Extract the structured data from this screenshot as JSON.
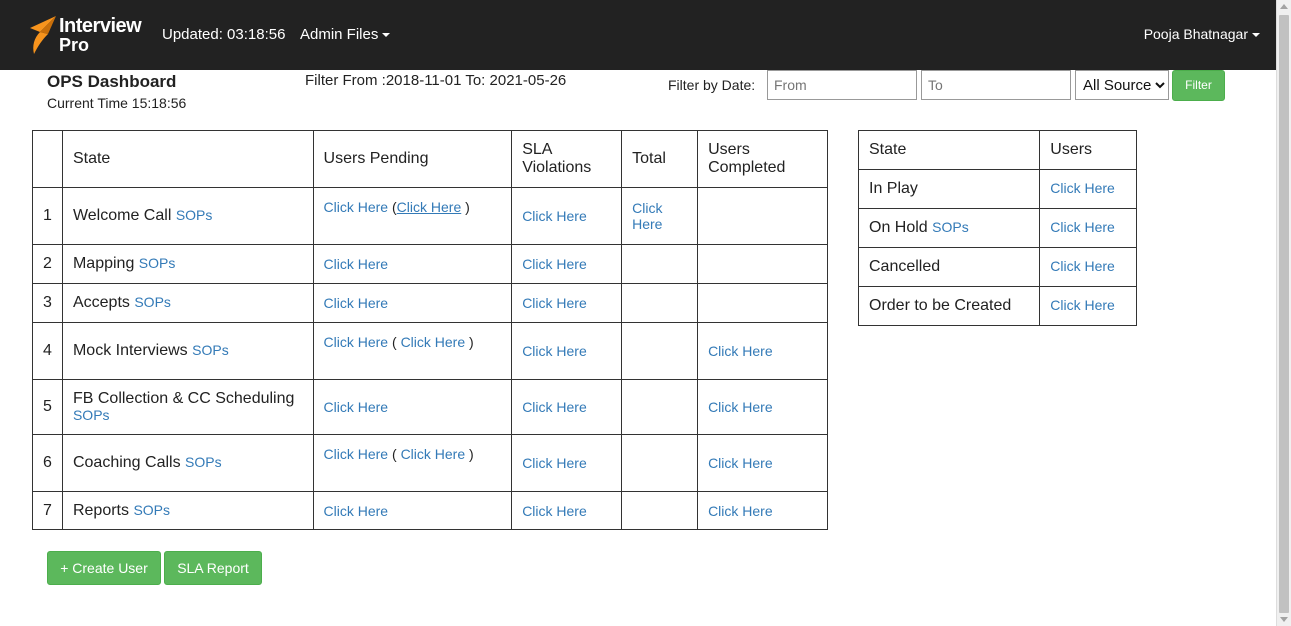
{
  "navbar": {
    "logo_line1": "Interview",
    "logo_line2": "Pro",
    "updated": "Updated: 03:18:56",
    "admin_files": "Admin Files",
    "user_name": "Pooja Bhatnagar",
    "brand_color": "#f7941d"
  },
  "header": {
    "title": "OPS Dashboard",
    "current_time": "Current Time 15:18:56",
    "filter_range": "Filter From :2018-11-01 To: 2021-05-26"
  },
  "filter": {
    "label": "Filter by Date:",
    "from_placeholder": "From",
    "to_placeholder": "To",
    "source_selected": "All Sources",
    "button": "Filter"
  },
  "main_table": {
    "headers": [
      "",
      "State",
      "Users Pending",
      "SLA Violations",
      "Total",
      "Users Completed"
    ],
    "link": "Click Here",
    "sops": "SOPs",
    "rows": [
      {
        "num": "1",
        "state": "Welcome Call"
      },
      {
        "num": "2",
        "state": "Mapping"
      },
      {
        "num": "3",
        "state": "Accepts"
      },
      {
        "num": "4",
        "state": "Mock Interviews"
      },
      {
        "num": "5",
        "state": "FB Collection & CC Scheduling"
      },
      {
        "num": "6",
        "state": "Coaching Calls"
      },
      {
        "num": "7",
        "state": "Reports"
      }
    ]
  },
  "side_table": {
    "headers": [
      "State",
      "Users"
    ],
    "rows": [
      {
        "state": "In Play"
      },
      {
        "state": "On Hold"
      },
      {
        "state": "Cancelled"
      },
      {
        "state": "Order to be Created"
      }
    ]
  },
  "actions": {
    "create_user": "+ Create User",
    "sla_report": "SLA Report"
  },
  "colors": {
    "navbar_bg": "#222222",
    "link": "#337ab7",
    "button_green": "#5cb85c"
  }
}
